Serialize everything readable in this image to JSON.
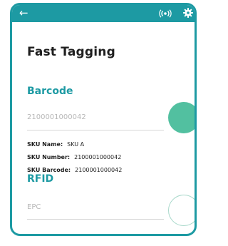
{
  "topbar": {
    "back_icon": "arrow-left-icon",
    "rfid_icon": "rfid-signal-icon",
    "settings_icon": "gear-icon",
    "background": "#1d9aa3"
  },
  "page": {
    "title": "Fast Tagging"
  },
  "barcode": {
    "heading": "Barcode",
    "value": "2100001000042",
    "scan_button_color": "#52c0a0",
    "sku_name_label": "SKU Name:",
    "sku_name_value": "SKU A",
    "sku_number_label": "SKU Number:",
    "sku_number_value": "2100001000042",
    "sku_barcode_label": "SKU Barcode:",
    "sku_barcode_value": "2100001000042"
  },
  "rfid": {
    "heading": "RFID",
    "epc_placeholder": "EPC"
  },
  "colors": {
    "accent": "#1d9aa3",
    "scan_green": "#52c0a0"
  }
}
